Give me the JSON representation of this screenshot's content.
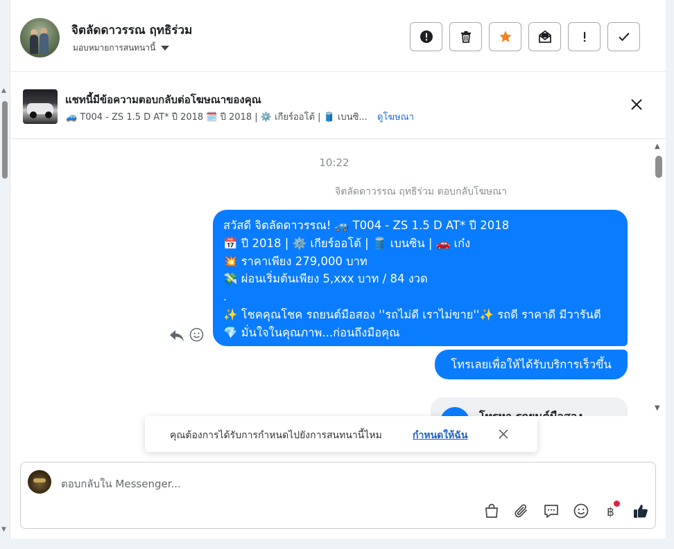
{
  "header": {
    "contact_name": "จิตลัดดาวรรณ ฤทธิร่วม",
    "assign_label": "มอบหมายการสนทนานี้",
    "actions": [
      {
        "icon": "alert-circle-icon",
        "name": "spam-button"
      },
      {
        "icon": "trash-icon",
        "name": "delete-button"
      },
      {
        "icon": "star-icon",
        "name": "star-button",
        "color": "#f0831e"
      },
      {
        "icon": "mail-open-icon",
        "name": "mark-unread-button"
      },
      {
        "icon": "exclamation-icon",
        "name": "follow-up-button"
      },
      {
        "icon": "check-icon",
        "name": "mark-done-button"
      }
    ]
  },
  "ad_banner": {
    "title": "แชทนี้มีข้อความตอบกลับต่อโฆษณาของคุณ",
    "subtitle": "🚙 T004 - ZS 1.5 D AT* ปี 2018 🗓️ ปี 2018 | ⚙️ เกียร์ออโต้ | 🛢️ เบนซิ...",
    "view_ad_link": "ดูโฆษณา"
  },
  "chat": {
    "timestamp": "10:22",
    "replied_note": "จิตลัดดาวรรณ ฤทธิร่วม ตอบกลับโฆษณา",
    "message_lines": [
      "สวัสดี จิตลัดดาวรรณ! 🚙 T004 - ZS 1.5 D AT* ปี 2018",
      "📅 ปี 2018 | ⚙️ เกียร์ออโต้ | 🛢️ เบนซิน | 🚗 เก๋ง",
      "💥 ราคาเพียง 279,000 บาท",
      "💸 ผ่อนเริ่มต้นเพียง 5,xxx บาท / 84 งวด",
      ".",
      "✨ โชคคุณโชค รถยนต์มือสอง ''รถไม่ดี เราไม่ขาย''✨ รถดี ราคาดี มีวารันตี",
      "💎 มั่นใจในคุณภาพ...ก่อนถึงมือคุณ"
    ],
    "call_button_message": "โทรเลยเพื่อให้ได้รับบริการเร็วขึ้น",
    "card_text": "โทรหา รถยนต์มือสอง",
    "bubble_color": "#0a7cff"
  },
  "toast": {
    "text": "คุณต้องการได้รับการกำหนดไปยังการสนทนานี้ไหม",
    "link": "กำหนดให้ฉัน"
  },
  "composer": {
    "placeholder": "ตอบกลับใน Messenger...",
    "tools": [
      "shopping-bag-icon",
      "paperclip-icon",
      "saved-reply-icon",
      "emoji-icon",
      "baht-icon",
      "like-icon"
    ]
  }
}
